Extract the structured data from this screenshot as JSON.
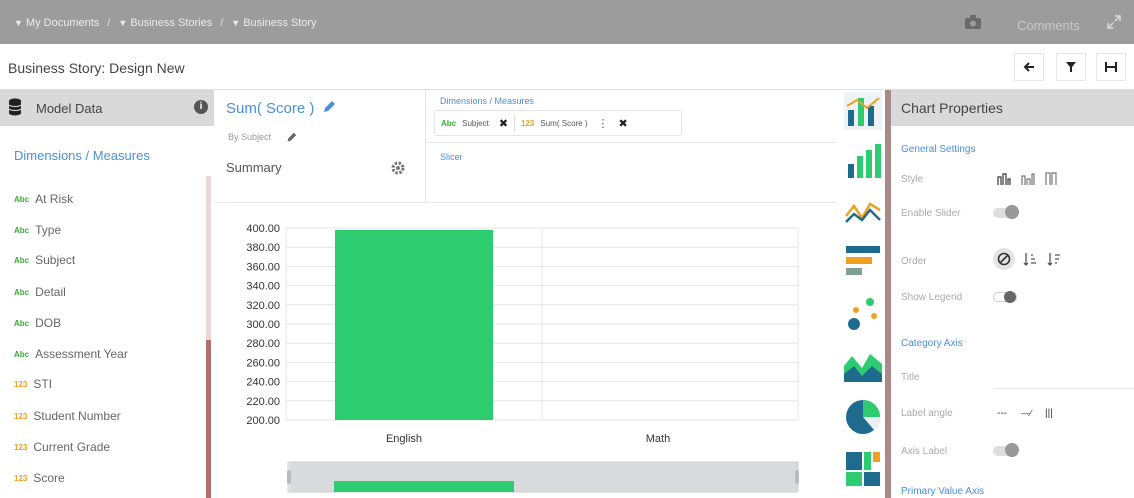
{
  "breadcrumb": {
    "items": [
      "My Documents",
      "Business Stories",
      "Business Story"
    ],
    "separator": "/"
  },
  "header": {
    "comments_label": "Comments"
  },
  "titlebar": {
    "title": "Business Story: Design New"
  },
  "left_panel": {
    "header": "Model Data",
    "section_title": "Dimensions / Measures",
    "fields": [
      {
        "badge": "Abc",
        "label": "At Risk"
      },
      {
        "badge": "Abc",
        "label": "Type"
      },
      {
        "badge": "Abc",
        "label": "Subject"
      },
      {
        "badge": "Abc",
        "label": "Detail"
      },
      {
        "badge": "Abc",
        "label": "DOB"
      },
      {
        "badge": "Abc",
        "label": "Assessment Year"
      },
      {
        "badge": "123",
        "label": "STI"
      },
      {
        "badge": "123",
        "label": "Student Number"
      },
      {
        "badge": "123",
        "label": "Current Grade"
      },
      {
        "badge": "123",
        "label": "Score"
      }
    ]
  },
  "summary": {
    "measure_title": "Sum( Score )",
    "by_label": "By Subject",
    "name": "Summary"
  },
  "dims": {
    "label": "Dimensions / Measures",
    "pills": [
      {
        "badge": "Abc",
        "label": "Subject"
      },
      {
        "badge": "123",
        "label": "Sum( Score )"
      }
    ],
    "slicer_label": "Slicer"
  },
  "chart_data": {
    "type": "bar",
    "categories": [
      "English",
      "Math"
    ],
    "values": [
      398,
      0
    ],
    "ylim": [
      200,
      400
    ],
    "yticks": [
      "400.00",
      "380.00",
      "360.00",
      "340.00",
      "320.00",
      "300.00",
      "280.00",
      "260.00",
      "240.00",
      "220.00",
      "200.00"
    ],
    "color": "#2ecc71",
    "grid": true
  },
  "chart_icons": [
    "combo-chart-icon",
    "bar-chart-icon",
    "line-chart-icon",
    "horizontal-bar-chart-icon",
    "scatter-chart-icon",
    "area-chart-icon",
    "pie-chart-icon",
    "treemap-chart-icon"
  ],
  "properties": {
    "header": "Chart Properties",
    "general_settings": "General Settings",
    "style": "Style",
    "enable_slider": "Enable Slider",
    "order": "Order",
    "show_legend": "Show Legend",
    "category_axis": "Category Axis",
    "title": "Title",
    "label_angle": "Label angle",
    "axis_label": "Axis Label",
    "primary_value_axis": "Primary Value Axis",
    "label_angle_options": [
      "---",
      "—∕",
      "|||"
    ]
  },
  "colors": {
    "accent": "#4a90d9",
    "bar": "#2ecc71",
    "abc": "#3aaa35",
    "num": "#f0a020"
  }
}
